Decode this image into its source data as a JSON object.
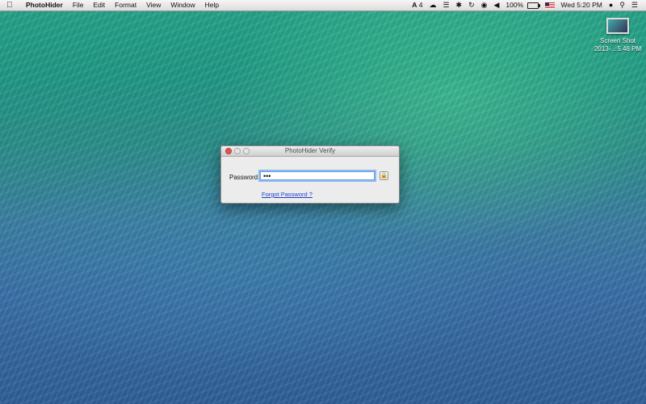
{
  "menubar": {
    "app_name": "PhotoHider",
    "items": [
      "File",
      "Edit",
      "Format",
      "View",
      "Window",
      "Help"
    ],
    "status": {
      "adobe_count": "4",
      "battery": "100%",
      "clock": "Wed 5:20 PM"
    }
  },
  "desktop": {
    "icon_label_line1": "Screen Shot",
    "icon_label_line2": "2013-…5.48 PM"
  },
  "dialog": {
    "title": "PhotoHider Verify",
    "password_label": "Password:",
    "password_value": "•••",
    "forgot_link": "Forgot Password ?"
  },
  "icons": {
    "apple": "apple-icon",
    "adobe": "adobe-icon",
    "cloud": "cloud-icon",
    "bluetooth": "bluetooth-icon",
    "time_machine": "time-machine-icon",
    "wifi": "wifi-icon",
    "volume": "volume-icon",
    "battery": "battery-icon",
    "flag": "us-flag-icon",
    "user": "user-icon",
    "spotlight": "search-icon",
    "notifications": "list-icon",
    "lock": "lock-icon"
  }
}
